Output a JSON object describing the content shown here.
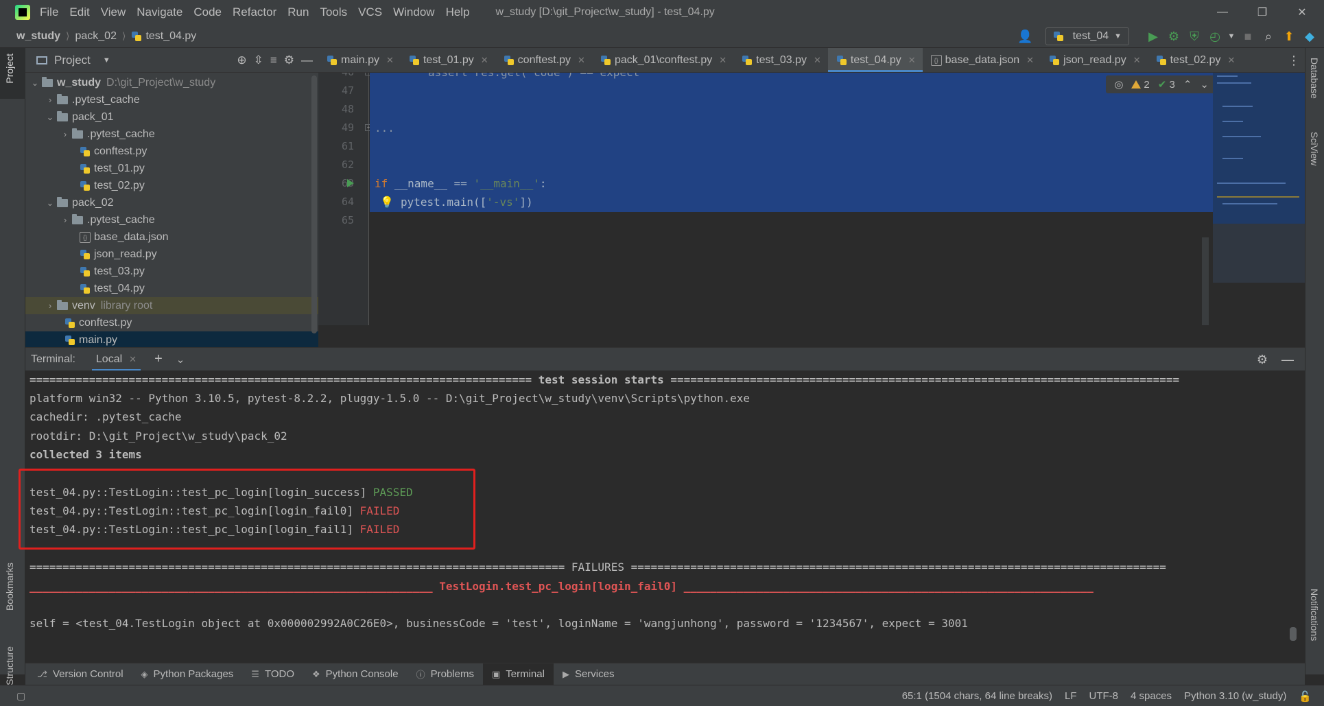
{
  "window": {
    "title": "w_study [D:\\git_Project\\w_study] - test_04.py",
    "menu": [
      "File",
      "Edit",
      "View",
      "Navigate",
      "Code",
      "Refactor",
      "Run",
      "Tools",
      "VCS",
      "Window",
      "Help"
    ]
  },
  "breadcrumb": {
    "project": "w_study",
    "folder": "pack_02",
    "file": "test_04.py"
  },
  "run_config": {
    "name": "test_04"
  },
  "left_strip": {
    "project_tab": "Project",
    "bookmarks_tab": "Bookmarks",
    "structure_tab": "Structure"
  },
  "right_strip": {
    "database_tab": "Database",
    "sciview_tab": "SciView",
    "notifications_tab": "Notifications"
  },
  "project_panel": {
    "title": "Project",
    "tree": [
      {
        "label": "w_study",
        "hint": "D:\\git_Project\\w_study"
      },
      {
        "label": ".pytest_cache"
      },
      {
        "label": "pack_01"
      },
      {
        "label": ".pytest_cache"
      },
      {
        "label": "conftest.py"
      },
      {
        "label": "test_01.py"
      },
      {
        "label": "test_02.py"
      },
      {
        "label": "pack_02"
      },
      {
        "label": ".pytest_cache"
      },
      {
        "label": "base_data.json"
      },
      {
        "label": "json_read.py"
      },
      {
        "label": "test_03.py"
      },
      {
        "label": "test_04.py"
      },
      {
        "label": "venv",
        "hint": "library root"
      },
      {
        "label": "conftest.py"
      },
      {
        "label": "main.py"
      }
    ]
  },
  "editor_tabs": [
    "main.py",
    "test_01.py",
    "conftest.py",
    "pack_01\\conftest.py",
    "test_03.py",
    "test_04.py",
    "base_data.json",
    "json_read.py",
    "test_02.py"
  ],
  "editor": {
    "line_numbers": [
      "46",
      "47",
      "48",
      "49",
      "61",
      "62",
      "63",
      "64",
      "65"
    ],
    "code_partial": "assert res.get('code') == expect",
    "code_fold": "...",
    "code_main_kw": "if",
    "code_main_rest": " __name__ == ",
    "code_main_str": "'__main__'",
    "code_main_colon": ":",
    "code_pytest_pre": "pytest.main([",
    "code_pytest_str": "'-vs'",
    "code_pytest_post": "])",
    "inspection": {
      "warnings": "2",
      "ok": "3"
    }
  },
  "terminal": {
    "label": "Terminal:",
    "tab": "Local",
    "lines": {
      "session": "============================================================================ test session starts =============================================================================",
      "platform": "platform win32 -- Python 3.10.5, pytest-8.2.2, pluggy-1.5.0 -- D:\\git_Project\\w_study\\venv\\Scripts\\python.exe",
      "cachedir": "cachedir: .pytest_cache",
      "rootdir": "rootdir: D:\\git_Project\\w_study\\pack_02",
      "collected": "collected 3 items",
      "t1_name": "test_04.py::TestLogin::test_pc_login[login_success] ",
      "t1_result": "PASSED",
      "t2_name": "test_04.py::TestLogin::test_pc_login[login_fail0] ",
      "t2_result": "FAILED",
      "t3_name": "test_04.py::TestLogin::test_pc_login[login_fail1] ",
      "t3_result": "FAILED",
      "failures": "================================================================================= FAILURES =================================================================================",
      "fail_header": "_____________________________________________________________ TestLogin.test_pc_login[login_fail0] ______________________________________________________________",
      "self_line": "self = <test_04.TestLogin object at 0x000002992A0C26E0>, businessCode = 'test', loginName = 'wangjunhong', password = '1234567', expect = 3001"
    }
  },
  "tool_windows": [
    "Version Control",
    "Python Packages",
    "TODO",
    "Python Console",
    "Problems",
    "Terminal",
    "Services"
  ],
  "status": {
    "position": "65:1 (1504 chars, 64 line breaks)",
    "line_sep": "LF",
    "encoding": "UTF-8",
    "indent": "4 spaces",
    "interpreter": "Python 3.10 (w_study)"
  },
  "colors": {
    "accent": "#4a88c7",
    "passed": "#5e9d57",
    "failed": "#e05555",
    "highlight_box": "#e0201e",
    "selection": "#214283"
  }
}
